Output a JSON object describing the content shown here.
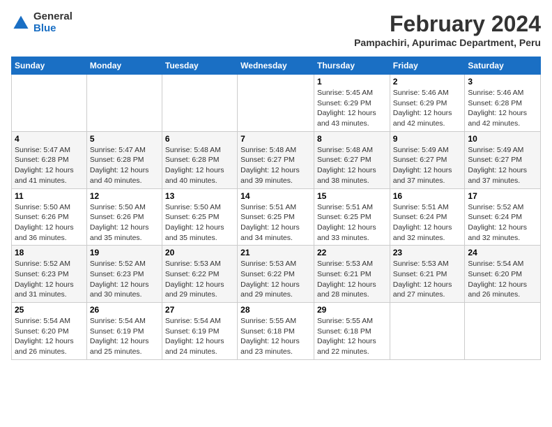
{
  "logo": {
    "general": "General",
    "blue": "Blue"
  },
  "header": {
    "month_year": "February 2024",
    "location": "Pampachiri, Apurimac Department, Peru"
  },
  "weekdays": [
    "Sunday",
    "Monday",
    "Tuesday",
    "Wednesday",
    "Thursday",
    "Friday",
    "Saturday"
  ],
  "weeks": [
    [
      {
        "day": "",
        "info": ""
      },
      {
        "day": "",
        "info": ""
      },
      {
        "day": "",
        "info": ""
      },
      {
        "day": "",
        "info": ""
      },
      {
        "day": "1",
        "info": "Sunrise: 5:45 AM\nSunset: 6:29 PM\nDaylight: 12 hours\nand 43 minutes."
      },
      {
        "day": "2",
        "info": "Sunrise: 5:46 AM\nSunset: 6:29 PM\nDaylight: 12 hours\nand 42 minutes."
      },
      {
        "day": "3",
        "info": "Sunrise: 5:46 AM\nSunset: 6:28 PM\nDaylight: 12 hours\nand 42 minutes."
      }
    ],
    [
      {
        "day": "4",
        "info": "Sunrise: 5:47 AM\nSunset: 6:28 PM\nDaylight: 12 hours\nand 41 minutes."
      },
      {
        "day": "5",
        "info": "Sunrise: 5:47 AM\nSunset: 6:28 PM\nDaylight: 12 hours\nand 40 minutes."
      },
      {
        "day": "6",
        "info": "Sunrise: 5:48 AM\nSunset: 6:28 PM\nDaylight: 12 hours\nand 40 minutes."
      },
      {
        "day": "7",
        "info": "Sunrise: 5:48 AM\nSunset: 6:27 PM\nDaylight: 12 hours\nand 39 minutes."
      },
      {
        "day": "8",
        "info": "Sunrise: 5:48 AM\nSunset: 6:27 PM\nDaylight: 12 hours\nand 38 minutes."
      },
      {
        "day": "9",
        "info": "Sunrise: 5:49 AM\nSunset: 6:27 PM\nDaylight: 12 hours\nand 37 minutes."
      },
      {
        "day": "10",
        "info": "Sunrise: 5:49 AM\nSunset: 6:27 PM\nDaylight: 12 hours\nand 37 minutes."
      }
    ],
    [
      {
        "day": "11",
        "info": "Sunrise: 5:50 AM\nSunset: 6:26 PM\nDaylight: 12 hours\nand 36 minutes."
      },
      {
        "day": "12",
        "info": "Sunrise: 5:50 AM\nSunset: 6:26 PM\nDaylight: 12 hours\nand 35 minutes."
      },
      {
        "day": "13",
        "info": "Sunrise: 5:50 AM\nSunset: 6:25 PM\nDaylight: 12 hours\nand 35 minutes."
      },
      {
        "day": "14",
        "info": "Sunrise: 5:51 AM\nSunset: 6:25 PM\nDaylight: 12 hours\nand 34 minutes."
      },
      {
        "day": "15",
        "info": "Sunrise: 5:51 AM\nSunset: 6:25 PM\nDaylight: 12 hours\nand 33 minutes."
      },
      {
        "day": "16",
        "info": "Sunrise: 5:51 AM\nSunset: 6:24 PM\nDaylight: 12 hours\nand 32 minutes."
      },
      {
        "day": "17",
        "info": "Sunrise: 5:52 AM\nSunset: 6:24 PM\nDaylight: 12 hours\nand 32 minutes."
      }
    ],
    [
      {
        "day": "18",
        "info": "Sunrise: 5:52 AM\nSunset: 6:23 PM\nDaylight: 12 hours\nand 31 minutes."
      },
      {
        "day": "19",
        "info": "Sunrise: 5:52 AM\nSunset: 6:23 PM\nDaylight: 12 hours\nand 30 minutes."
      },
      {
        "day": "20",
        "info": "Sunrise: 5:53 AM\nSunset: 6:22 PM\nDaylight: 12 hours\nand 29 minutes."
      },
      {
        "day": "21",
        "info": "Sunrise: 5:53 AM\nSunset: 6:22 PM\nDaylight: 12 hours\nand 29 minutes."
      },
      {
        "day": "22",
        "info": "Sunrise: 5:53 AM\nSunset: 6:21 PM\nDaylight: 12 hours\nand 28 minutes."
      },
      {
        "day": "23",
        "info": "Sunrise: 5:53 AM\nSunset: 6:21 PM\nDaylight: 12 hours\nand 27 minutes."
      },
      {
        "day": "24",
        "info": "Sunrise: 5:54 AM\nSunset: 6:20 PM\nDaylight: 12 hours\nand 26 minutes."
      }
    ],
    [
      {
        "day": "25",
        "info": "Sunrise: 5:54 AM\nSunset: 6:20 PM\nDaylight: 12 hours\nand 26 minutes."
      },
      {
        "day": "26",
        "info": "Sunrise: 5:54 AM\nSunset: 6:19 PM\nDaylight: 12 hours\nand 25 minutes."
      },
      {
        "day": "27",
        "info": "Sunrise: 5:54 AM\nSunset: 6:19 PM\nDaylight: 12 hours\nand 24 minutes."
      },
      {
        "day": "28",
        "info": "Sunrise: 5:55 AM\nSunset: 6:18 PM\nDaylight: 12 hours\nand 23 minutes."
      },
      {
        "day": "29",
        "info": "Sunrise: 5:55 AM\nSunset: 6:18 PM\nDaylight: 12 hours\nand 22 minutes."
      },
      {
        "day": "",
        "info": ""
      },
      {
        "day": "",
        "info": ""
      }
    ]
  ]
}
